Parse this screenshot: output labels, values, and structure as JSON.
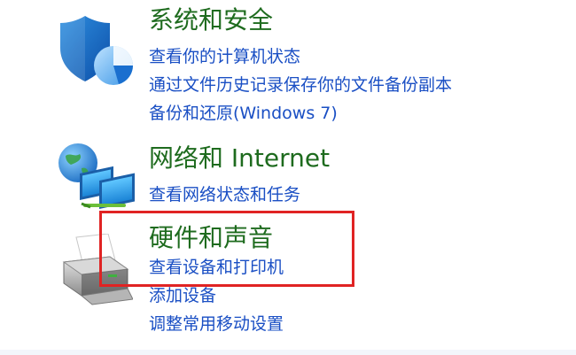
{
  "categories": [
    {
      "title": "系统和安全",
      "icon": "shield-icon",
      "links": [
        "查看你的计算机状态",
        "通过文件历史记录保存你的文件备份副本",
        "备份和还原(Windows 7)"
      ]
    },
    {
      "title": "网络和 Internet",
      "icon": "network-globe-icon",
      "links": [
        "查看网络状态和任务"
      ]
    },
    {
      "title": "硬件和声音",
      "icon": "printer-icon",
      "links": [
        "查看设备和打印机",
        "添加设备",
        "调整常用移动设置"
      ]
    }
  ],
  "colors": {
    "title": "#1e6b1e",
    "link": "#1a4fc4",
    "highlight": "#e02323"
  }
}
